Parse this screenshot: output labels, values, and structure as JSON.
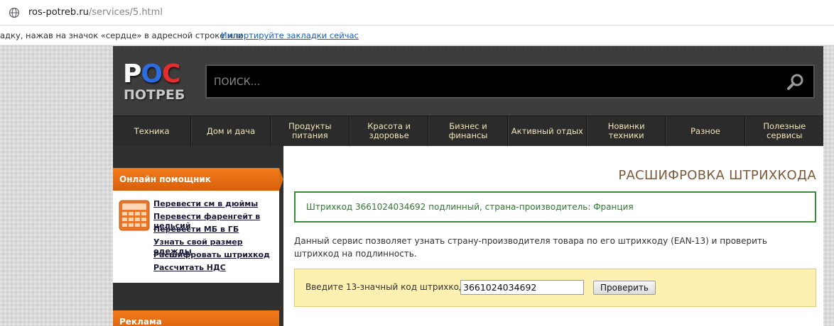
{
  "browser": {
    "url_host": "ros-potreb.ru",
    "url_path": "/services/5.html",
    "bookmark_prompt": "адку, нажав на значок «сердце» в адресной строке или",
    "bookmark_link": "Импортируйте закладки сейчас"
  },
  "site": {
    "logo_top": [
      "Р",
      "О",
      "С"
    ],
    "logo_bottom": "ПОТРЕБ",
    "search_placeholder": "ПОИСК...",
    "nav": [
      "Техника",
      "Дом и дача",
      "Продукты питания",
      "Красота и здоровье",
      "Бизнес и финансы",
      "Активный отдых",
      "Новинки техники",
      "Разное",
      "Полезные сервисы"
    ]
  },
  "sidebar": {
    "widget_title": "Онлайн помощник",
    "tools": [
      "Перевести см в дюймы",
      "Перевести фаренгейт в цельсий",
      "Перевести МБ в ГБ",
      "Узнать свой размер одежды",
      "Расшифровать штрихкод",
      "Рассчитать НДС"
    ],
    "ad_title": "Реклама"
  },
  "content": {
    "page_title": "РАСШИФРОВКА ШТРИХКОДА",
    "result": "Штрихкод 3661024034692 подлинный, страна-производитель: Франция",
    "description": "Данный сервис позволяет узнать страну-производителя товара по его штрихкоду (EAN-13) и проверить штрихкод на подлинность.",
    "form_label": "Введите 13-значный код штрихкода:",
    "input_value": "3661024034692",
    "button_label": "Проверить"
  },
  "icons": {
    "address_bar": "globe-icon",
    "search": "search-icon",
    "widget": "calculator-icon"
  },
  "colors": {
    "accent_orange": "#f27c1c",
    "result_green": "#3a8a3a",
    "form_yellow": "#fdf0b0",
    "nav_text": "#f2e6b8"
  }
}
